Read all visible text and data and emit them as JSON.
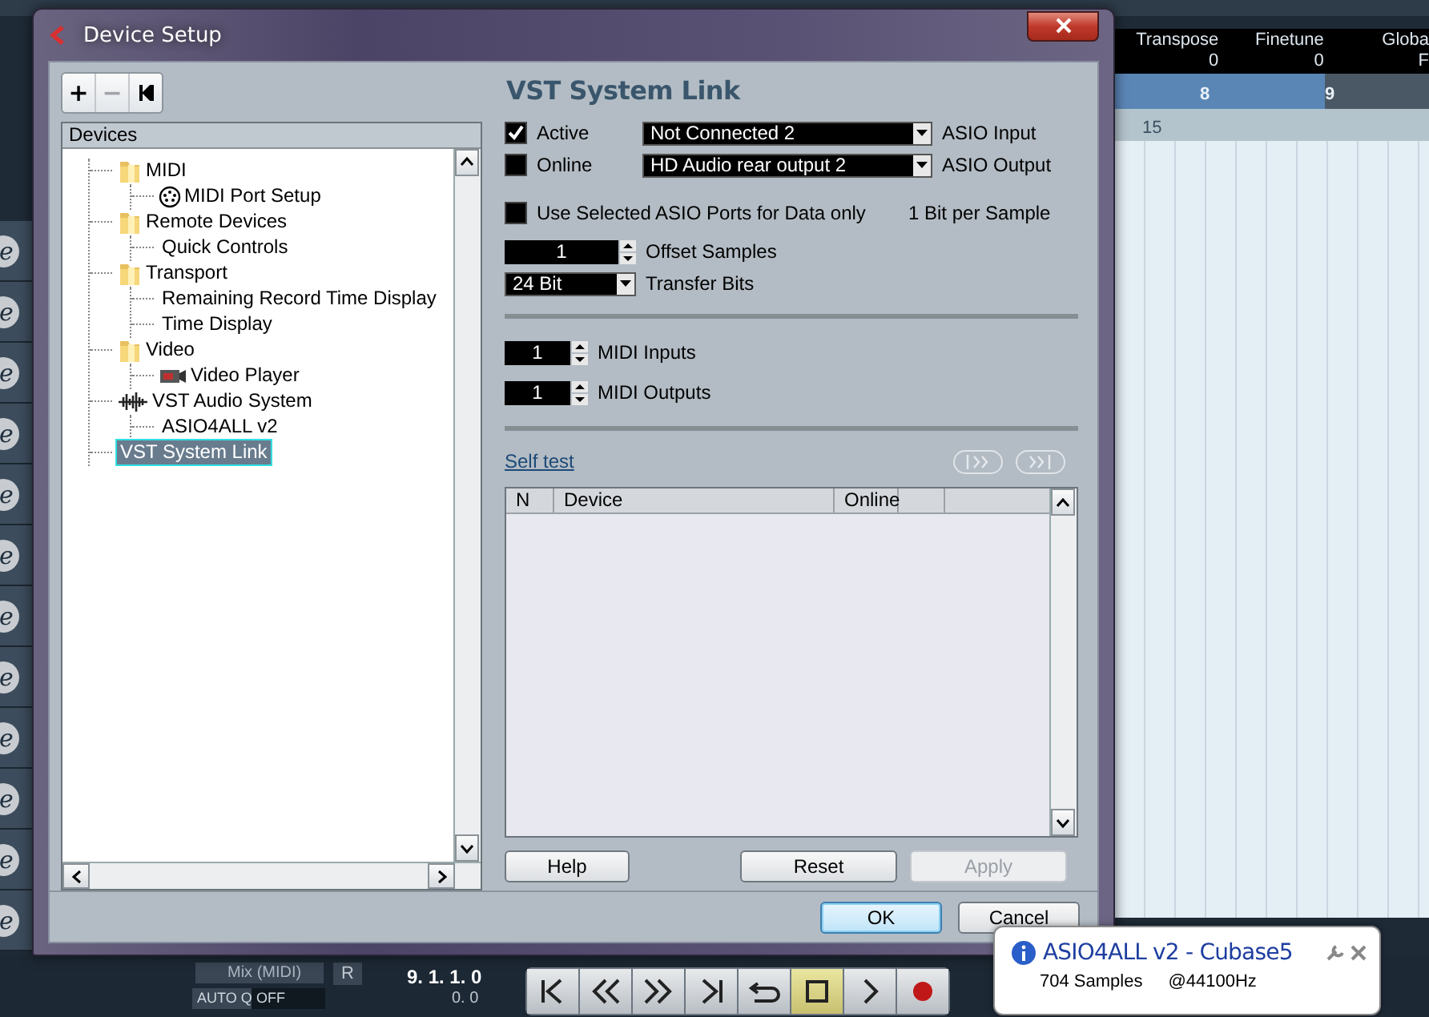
{
  "project": {
    "inspector": [
      {
        "label": "Transpose",
        "value": "0"
      },
      {
        "label": "Finetune",
        "value": "0"
      },
      {
        "label": "Globa",
        "value": "F"
      }
    ],
    "ruler": [
      "8",
      "9"
    ],
    "bar_number": "15",
    "track_edit_buttons": [
      "e",
      "e",
      "e",
      "e",
      "e",
      "e",
      "e",
      "e",
      "e",
      "e",
      "e",
      "e"
    ],
    "mix_label": "Mix (MIDI)",
    "auto_q": "AUTO Q",
    "auto_q_value": "OFF",
    "r_button": "R",
    "position": "9. 1. 1. 0",
    "position_sub": "0. 0",
    "transport": [
      {
        "kind": "to-start",
        "on": false
      },
      {
        "kind": "rewind",
        "on": false
      },
      {
        "kind": "forward",
        "on": false
      },
      {
        "kind": "to-end",
        "on": false
      },
      {
        "kind": "cycle",
        "on": false
      },
      {
        "kind": "stop",
        "on": true
      },
      {
        "kind": "play",
        "on": false
      },
      {
        "kind": "record",
        "on": false
      }
    ]
  },
  "window": {
    "title": "Device Setup"
  },
  "toolbar": [
    "+",
    "−"
  ],
  "tree": {
    "header": "Devices",
    "items": [
      {
        "label": "MIDI",
        "kind": "folder",
        "selected": false,
        "children": [
          {
            "label": "MIDI Port Setup",
            "kind": "midi",
            "selected": false
          }
        ]
      },
      {
        "label": "Remote Devices",
        "kind": "folder",
        "selected": false,
        "children": [
          {
            "label": "Quick Controls",
            "kind": "none",
            "selected": false
          }
        ]
      },
      {
        "label": "Transport",
        "kind": "folder",
        "selected": false,
        "children": [
          {
            "label": "Remaining Record Time Display",
            "kind": "none",
            "selected": false
          },
          {
            "label": "Time Display",
            "kind": "none",
            "selected": false
          }
        ]
      },
      {
        "label": "Video",
        "kind": "folder",
        "selected": false,
        "children": [
          {
            "label": "Video Player",
            "kind": "camera",
            "selected": false
          }
        ]
      },
      {
        "label": "VST Audio System",
        "kind": "audio",
        "selected": false,
        "children": [
          {
            "label": "ASIO4ALL v2",
            "kind": "none",
            "selected": false
          }
        ]
      },
      {
        "label": "VST System Link",
        "kind": "none",
        "selected": true
      }
    ]
  },
  "panel": {
    "title": "VST System Link",
    "active": {
      "label": "Active",
      "checked": true
    },
    "online": {
      "label": "Online",
      "checked": false
    },
    "asio_input": {
      "value": "Not Connected 2",
      "label": "ASIO Input"
    },
    "asio_output": {
      "value": "HD Audio rear output 2",
      "label": "ASIO Output"
    },
    "use_selected_ports": {
      "label": "Use Selected ASIO Ports for Data only",
      "checked": false
    },
    "bit_note": "1 Bit per Sample",
    "offset_samples": {
      "value": "1",
      "label": "Offset Samples"
    },
    "transfer_bits": {
      "value": "24 Bit",
      "label": "Transfer Bits"
    },
    "midi_inputs": {
      "value": "1",
      "label": "MIDI Inputs"
    },
    "midi_outputs": {
      "value": "1",
      "label": "MIDI Outputs"
    },
    "self_test": "Self test",
    "table": {
      "columns": [
        "N",
        "Device",
        "Online"
      ]
    },
    "buttons": [
      {
        "label": "Help",
        "disabled": false
      },
      {
        "label": "Reset",
        "disabled": false
      },
      {
        "label": "Apply",
        "disabled": true
      }
    ]
  },
  "dialog_buttons": [
    {
      "label": "OK",
      "default": true
    },
    {
      "label": "Cancel",
      "default": false
    }
  ],
  "notification": {
    "title": "ASIO4ALL v2 - Cubase5",
    "detail_1": "704 Samples",
    "detail_2": "@44100Hz"
  }
}
